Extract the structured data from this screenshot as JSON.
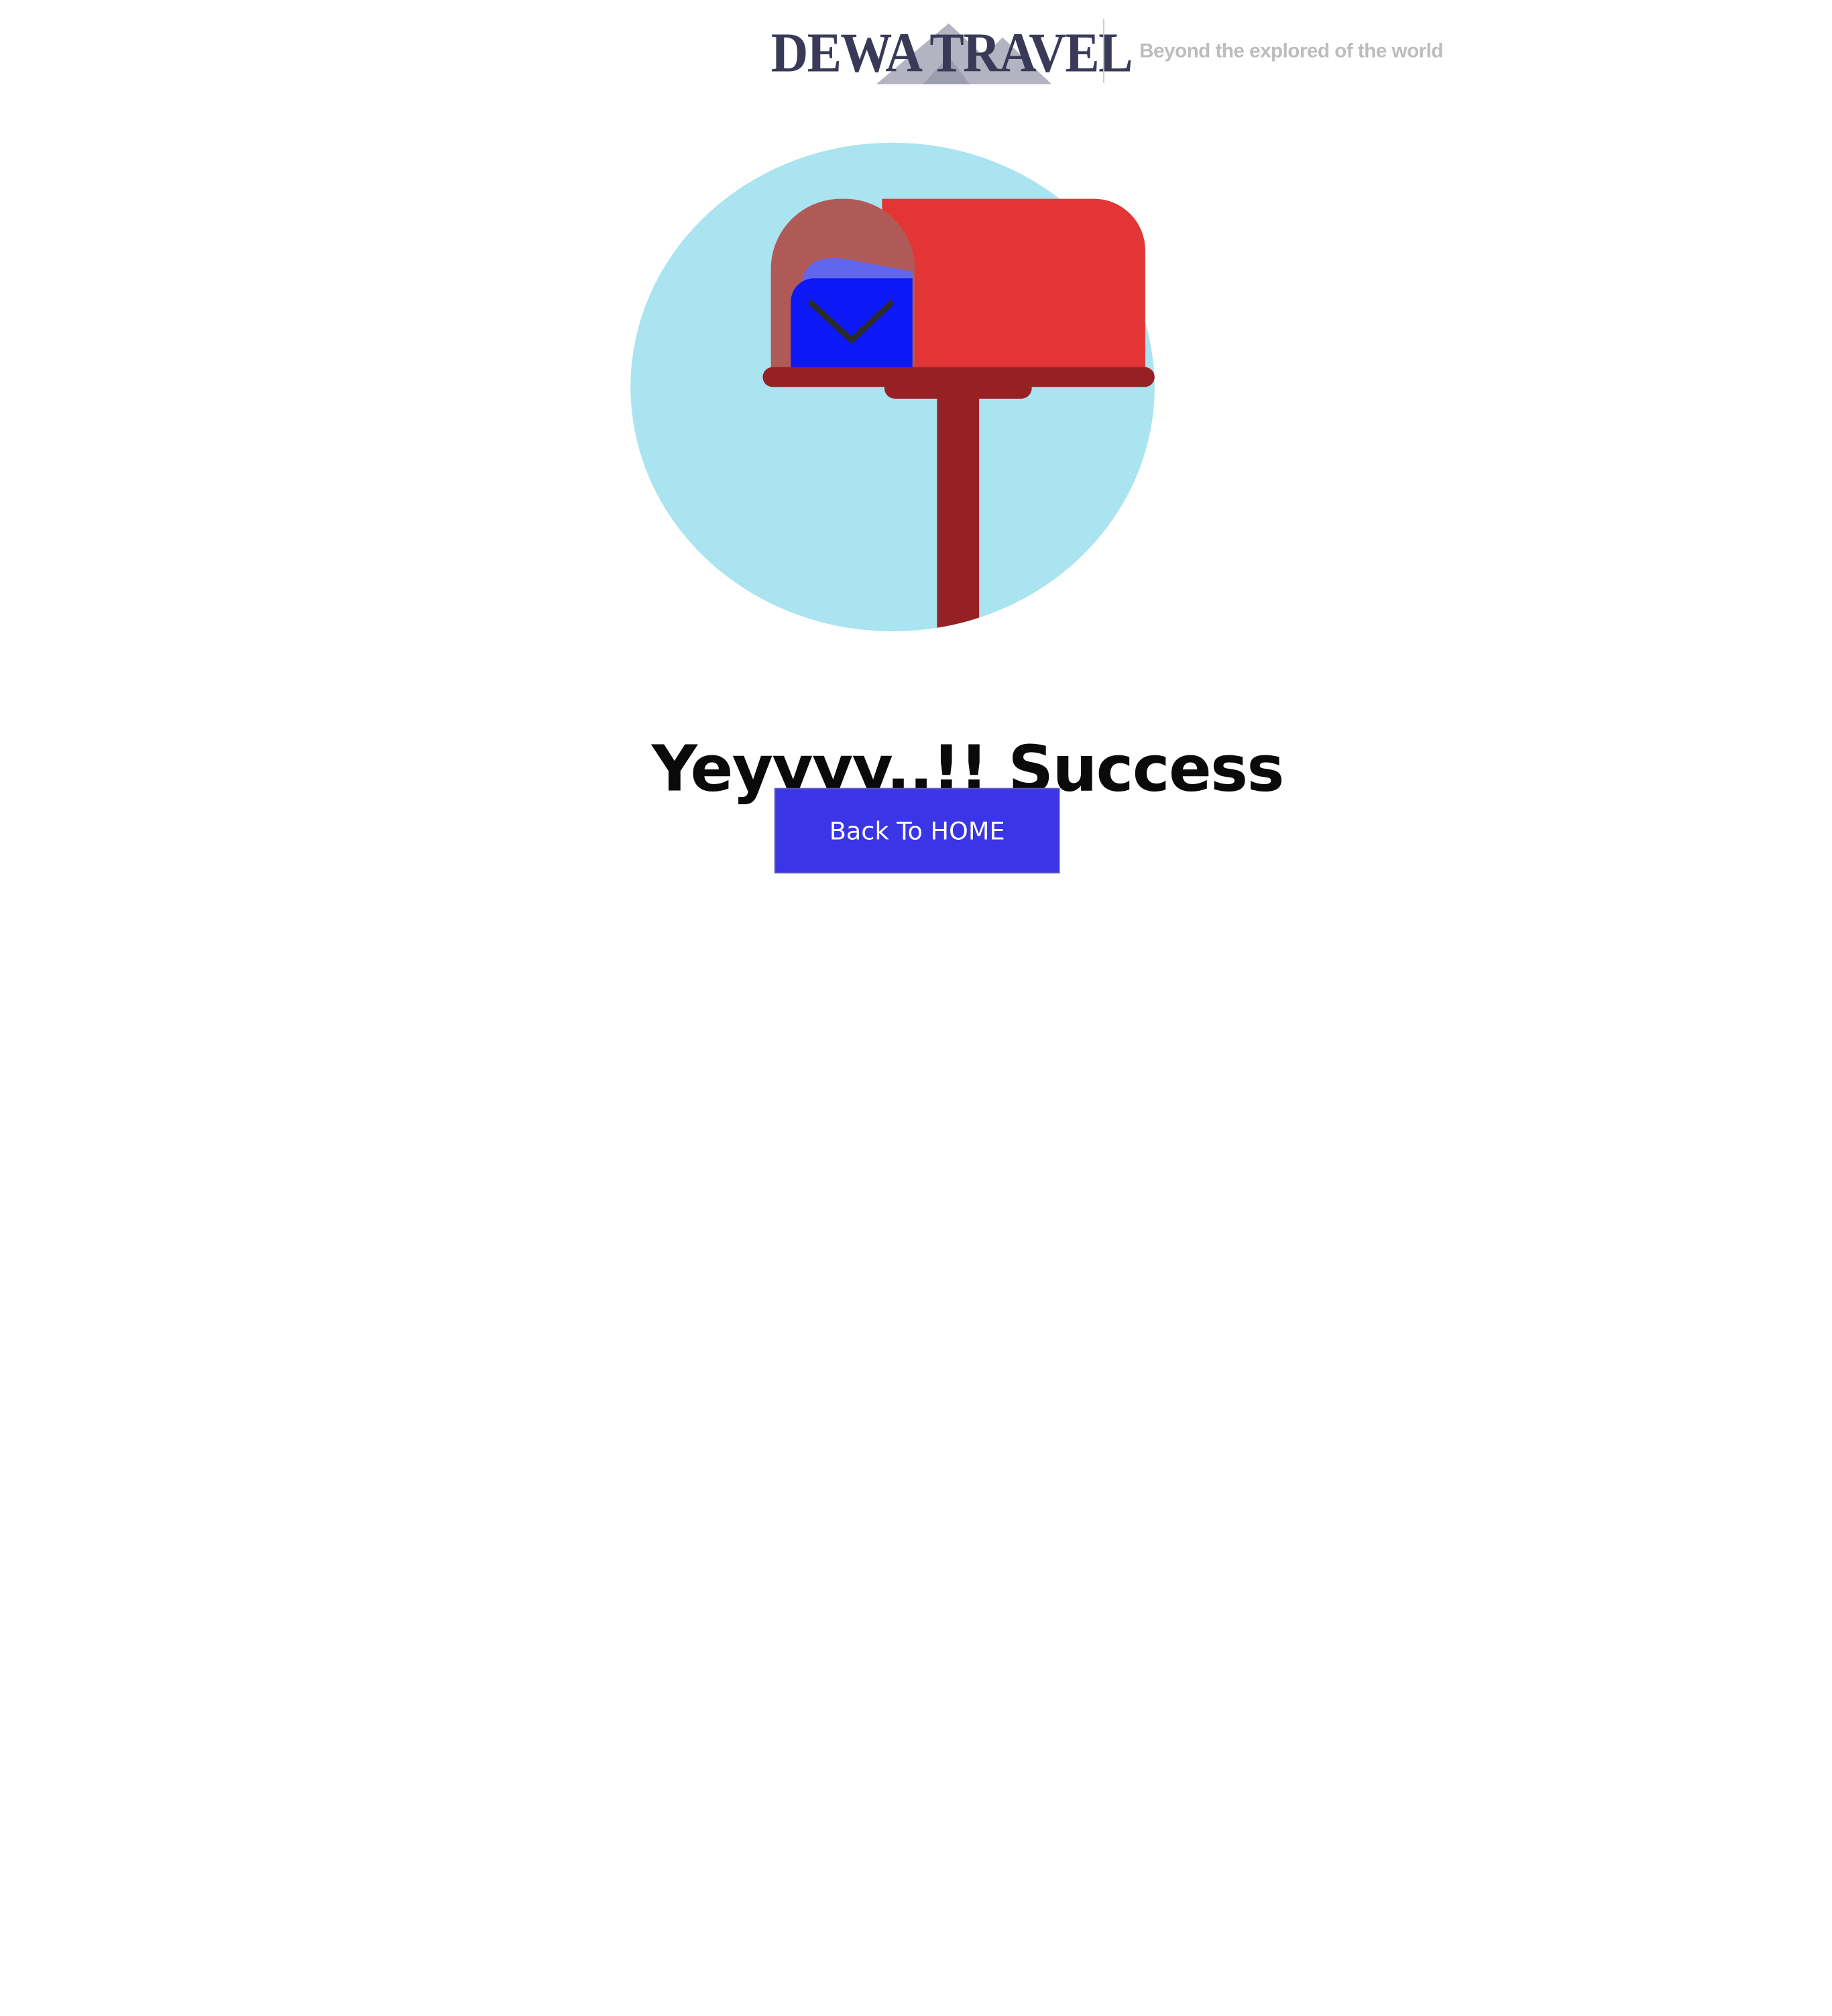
{
  "header": {
    "logo_text": "DEWA TRAVEL",
    "tagline": "Beyond the explored of the world"
  },
  "main": {
    "title": "Yeyyyy..!! Success",
    "back_button_label": "Back To HOME"
  },
  "colors": {
    "logo": "#3a3a58",
    "tagline": "#bdbdbd",
    "circle": "#a9e4f0",
    "mailbox_body": "#e33535",
    "mailbox_post": "#962125",
    "mail_envelope": "#0d18f7",
    "button": "#3a35e6"
  }
}
